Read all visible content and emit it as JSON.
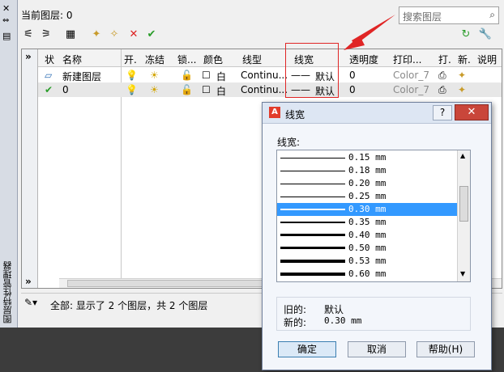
{
  "palette": {
    "title": "图层特性管理器"
  },
  "current_layer": "当前图层: 0",
  "search": {
    "placeholder": "搜索图层"
  },
  "columns": [
    "状",
    "名称",
    "开.",
    "冻结",
    "锁...",
    "颜色",
    "线型",
    "线宽",
    "透明度",
    "打印...",
    "打.",
    "新.",
    "说明"
  ],
  "rows": [
    {
      "name": "新建图层",
      "color": "白",
      "linetype": "Continu...",
      "lineweight": "默认",
      "transparency": "0",
      "plotstyle": "Color_7"
    },
    {
      "name": "0",
      "color": "白",
      "linetype": "Continu...",
      "lineweight": "默认",
      "transparency": "0",
      "plotstyle": "Color_7"
    }
  ],
  "status": "全部: 显示了 2 个图层，共 2 个图层",
  "dialog": {
    "title": "线宽",
    "help": "?",
    "list_label": "线宽:",
    "options": [
      "0.15 mm",
      "0.18 mm",
      "0.20 mm",
      "0.25 mm",
      "0.30 mm",
      "0.35 mm",
      "0.40 mm",
      "0.50 mm",
      "0.53 mm",
      "0.60 mm"
    ],
    "selected": "0.30 mm",
    "old_label": "旧的:",
    "old_value": "默认",
    "new_label": "新的:",
    "new_value": "0.30 mm",
    "ok": "确定",
    "cancel": "取消",
    "help_btn": "帮助(H)"
  },
  "colors": {
    "highlight": "#e02525",
    "selection": "#3399ff"
  }
}
